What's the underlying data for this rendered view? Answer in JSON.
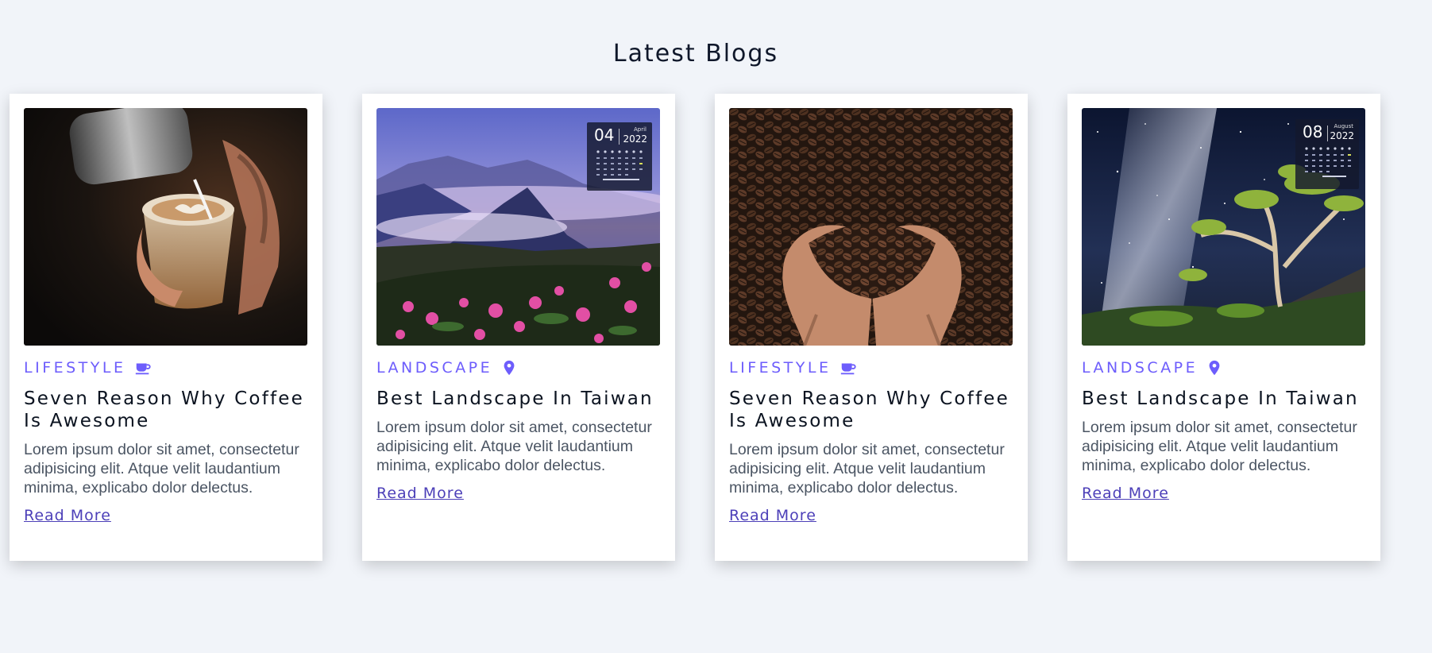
{
  "header": {
    "title": "Latest Blogs"
  },
  "colors": {
    "accent": "#6d5dfc",
    "link": "#4c3fb8",
    "background": "#f1f4f9"
  },
  "cards": [
    {
      "category": "LIFESTYLE",
      "category_icon": "coffee-cup-icon",
      "image": "latte-art-photo",
      "title": "Seven Reason Why Coffee Is Awesome",
      "excerpt": "Lorem ipsum dolor sit amet, consectetur adipisicing elit. Atque velit laudantium minima, explicabo dolor delectus.",
      "link": "Read More"
    },
    {
      "category": "LANDSCAPE",
      "category_icon": "map-pin-icon",
      "image": "taiwan-mountains-photo",
      "calendar": {
        "day": "04",
        "month": "April",
        "year": "2022"
      },
      "title": "Best Landscape In Taiwan",
      "excerpt": "Lorem ipsum dolor sit amet, consectetur adipisicing elit. Atque velit laudantium minima, explicabo dolor delectus.",
      "link": "Read More"
    },
    {
      "category": "LIFESTYLE",
      "category_icon": "coffee-cup-icon",
      "image": "coffee-beans-hands-photo",
      "title": "Seven Reason Why Coffee Is Awesome",
      "excerpt": "Lorem ipsum dolor sit amet, consectetur adipisicing elit. Atque velit laudantium minima, explicabo dolor delectus.",
      "link": "Read More"
    },
    {
      "category": "LANDSCAPE",
      "category_icon": "map-pin-icon",
      "image": "milky-way-tree-photo",
      "calendar": {
        "day": "08",
        "month": "August",
        "year": "2022"
      },
      "title": "Best Landscape In Taiwan",
      "excerpt": "Lorem ipsum dolor sit amet, consectetur adipisicing elit. Atque velit laudantium minima, explicabo dolor delectus.",
      "link": "Read More"
    }
  ]
}
